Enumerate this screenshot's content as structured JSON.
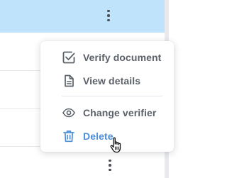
{
  "menu": {
    "items": [
      {
        "label": "Verify document",
        "icon": "check-square-icon"
      },
      {
        "label": "View details",
        "icon": "document-icon"
      },
      {
        "label": "Change verifier",
        "icon": "eye-icon"
      },
      {
        "label": "Delete",
        "icon": "trash-icon"
      }
    ]
  },
  "colors": {
    "selected_row": "#bfe3fa",
    "menu_text": "#5b6168",
    "delete_hover_text": "#4d8fd6"
  }
}
